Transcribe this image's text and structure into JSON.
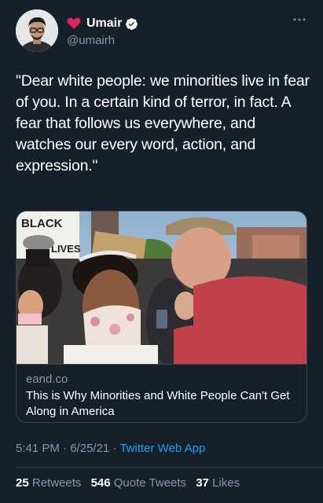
{
  "author": {
    "display_name": "Umair",
    "handle": "@umairh",
    "avatar_icon": "user-portrait",
    "name_prefix_icon": "red-heart-emoji",
    "verified": true
  },
  "tweet": {
    "text": "\"Dear white people: we minorities live in fear of you. In a certain kind of terror, in fact. A fear that follows us everywhere, and watches our every word, action, and expression.\""
  },
  "card": {
    "domain": "eand.co",
    "title": "This is Why Minorities and White People Can't Get Along in America",
    "image_description_icon": "protest-photo",
    "sign_text_1": "BLACK",
    "sign_text_2": "LIVES"
  },
  "meta": {
    "time": "5:41 PM",
    "separator": "·",
    "date": "6/25/21",
    "source": "Twitter Web App"
  },
  "stats": {
    "retweets_count": "25",
    "retweets_label": "Retweets",
    "quote_count": "546",
    "quote_label": "Quote Tweets",
    "likes_count": "37",
    "likes_label": "Likes"
  },
  "colors": {
    "background": "#15202b",
    "text_primary": "#ffffff",
    "text_secondary": "#8899a6",
    "link": "#1da1f2",
    "border": "#38444d",
    "verified": "#ffffff"
  }
}
